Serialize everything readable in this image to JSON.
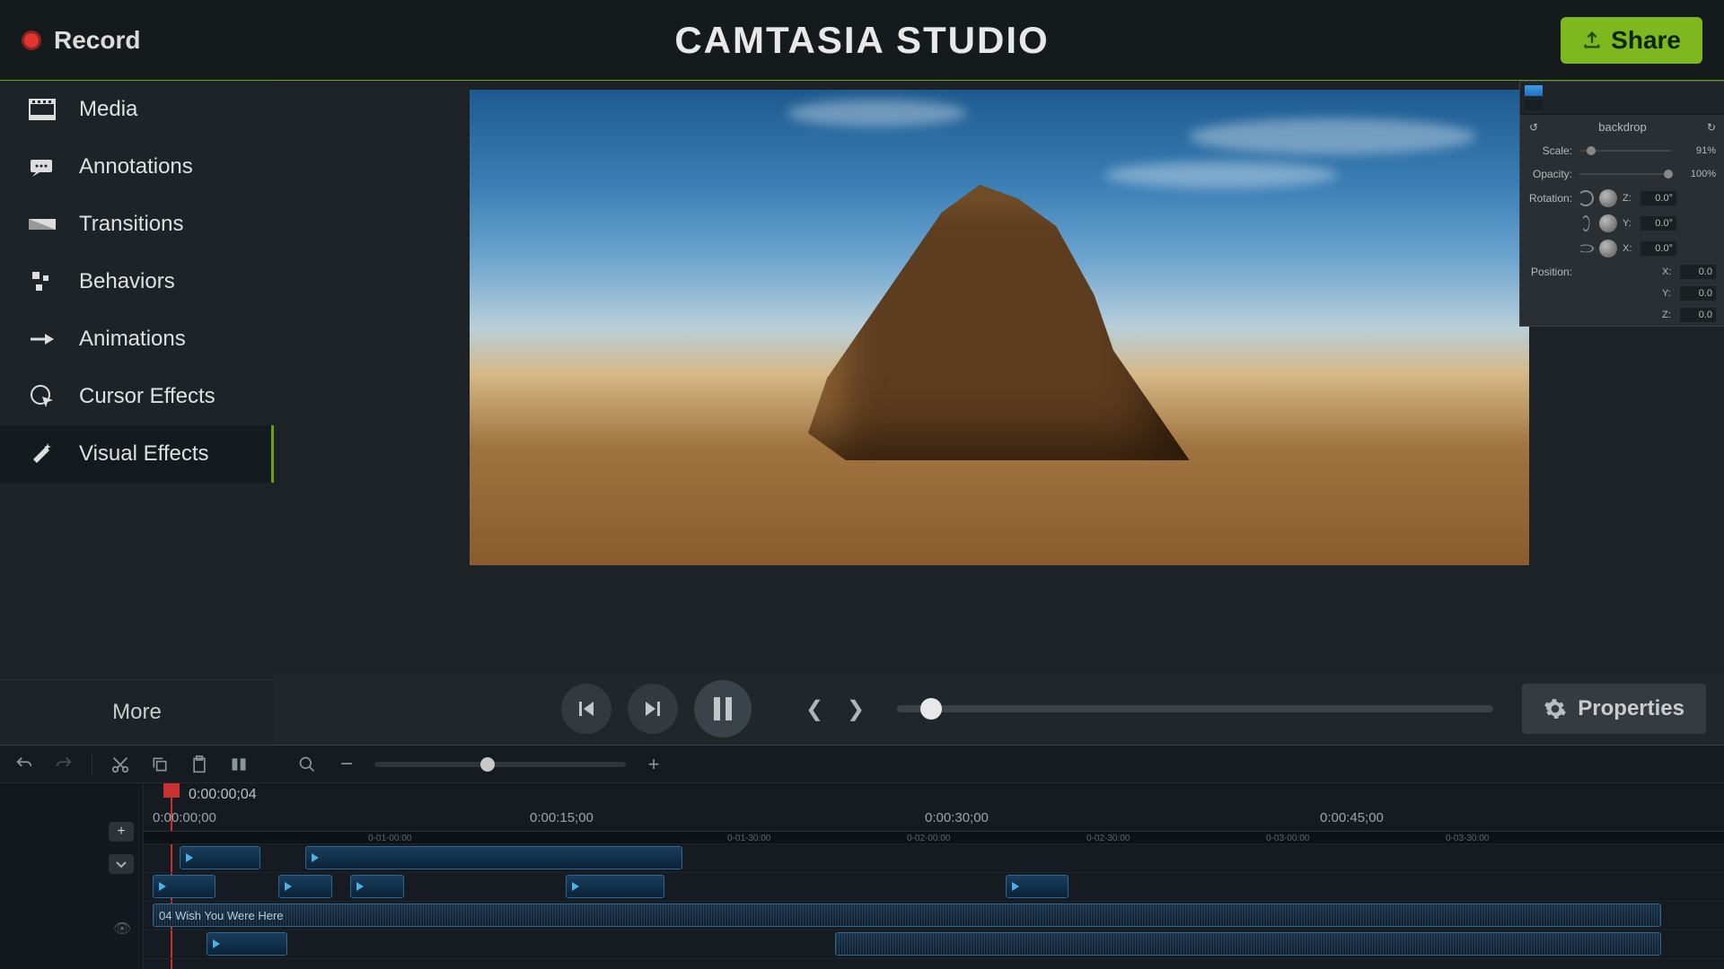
{
  "header": {
    "record_label": "Record",
    "app_title": "CAMTASIA STUDIO",
    "share_label": "Share"
  },
  "sidebar": {
    "items": [
      {
        "label": "Media",
        "icon": "media"
      },
      {
        "label": "Annotations",
        "icon": "annotations"
      },
      {
        "label": "Transitions",
        "icon": "transitions"
      },
      {
        "label": "Behaviors",
        "icon": "behaviors"
      },
      {
        "label": "Animations",
        "icon": "animations"
      },
      {
        "label": "Cursor Effects",
        "icon": "cursor"
      },
      {
        "label": "Visual Effects",
        "icon": "visual"
      }
    ],
    "more_label": "More",
    "active_index": 6
  },
  "properties_panel": {
    "title": "backdrop",
    "scale": {
      "label": "Scale:",
      "value": "91%",
      "pos": 8
    },
    "opacity": {
      "label": "Opacity:",
      "value": "100%",
      "pos": 92
    },
    "rotation": {
      "label": "Rotation:",
      "axes": [
        {
          "axis": "Z:",
          "value": "0.0°"
        },
        {
          "axis": "Y:",
          "value": "0.0°"
        },
        {
          "axis": "X:",
          "value": "0.0°"
        }
      ]
    },
    "position": {
      "label": "Position:",
      "axes": [
        {
          "axis": "X:",
          "value": "0.0"
        },
        {
          "axis": "Y:",
          "value": "0.0"
        },
        {
          "axis": "Z:",
          "value": "0.0"
        }
      ]
    }
  },
  "playbar": {
    "properties_label": "Properties"
  },
  "timeline": {
    "current_time": "0:00:00;04",
    "ruler": [
      "0:00:00;00",
      "0:00:15;00",
      "0:00:30;00",
      "0:00:45;00"
    ],
    "ruler_small": [
      "0-01-00:00",
      "0-01-30:00",
      "0-02-00:00",
      "0-02-30:00",
      "0-03-00:00",
      "0-03-30:00"
    ],
    "audio_clip_label": "04 Wish You Were Here"
  }
}
